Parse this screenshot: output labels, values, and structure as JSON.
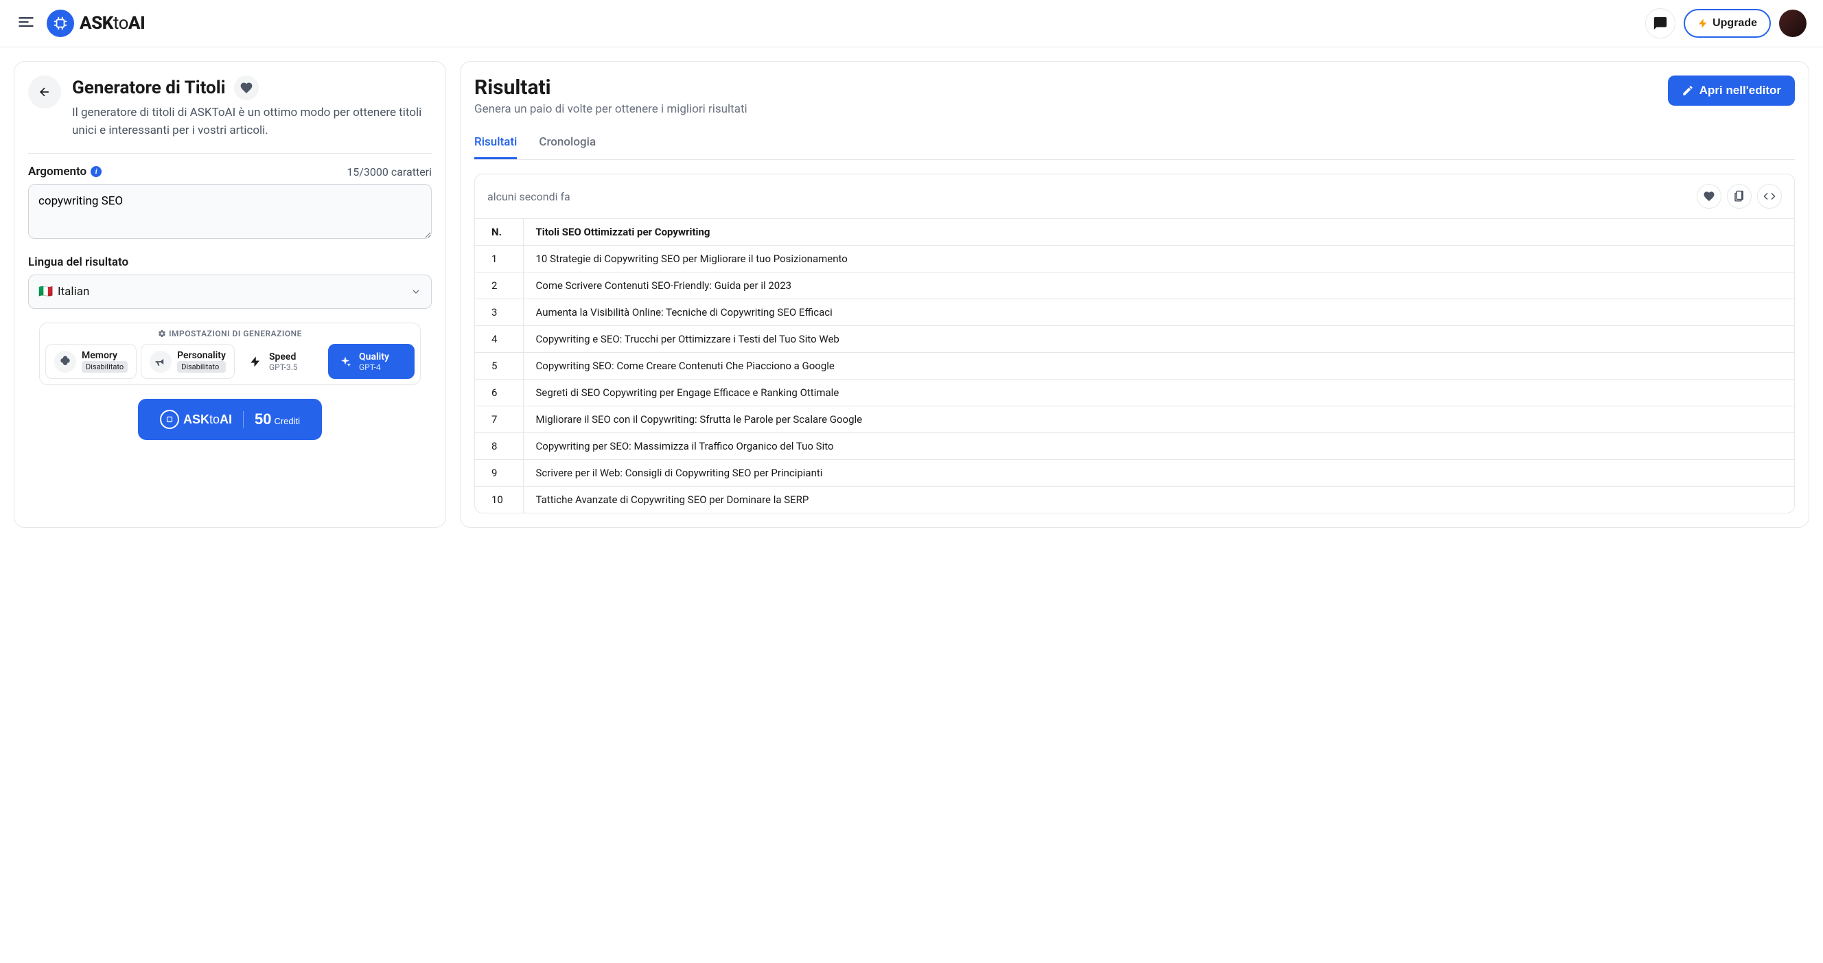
{
  "header": {
    "brand_ask": "ASK",
    "brand_to": "to",
    "brand_ai": "AI",
    "upgrade": "Upgrade"
  },
  "tool": {
    "title": "Generatore di Titoli",
    "description": "Il generatore di titoli di ASKToAI è un ottimo modo per ottenere titoli unici e interessanti per i vostri articoli."
  },
  "form": {
    "argomento_label": "Argomento",
    "char_count": "15/3000 caratteri",
    "argomento_value": "copywriting SEO",
    "lingua_label": "Lingua del risultato",
    "lingua_value": "Italian",
    "lingua_flag": "🇮🇹"
  },
  "gen": {
    "settings_title": "IMPOSTAZIONI DI GENERAZIONE",
    "memory_label": "Memory",
    "memory_status": "Disabilitato",
    "personality_label": "Personality",
    "personality_status": "Disabilitato",
    "speed_label": "Speed",
    "speed_sub": "GPT-3.5",
    "quality_label": "Quality",
    "quality_sub": "GPT-4"
  },
  "ask_button": {
    "brand_ask": "ASK",
    "brand_to": "to",
    "brand_ai": "AI",
    "credits_num": "50",
    "credits_label": "Crediti"
  },
  "results": {
    "title": "Risultati",
    "subtitle": "Genera un paio di volte per ottenere i migliori risultati",
    "editor_button": "Apri nell'editor",
    "tabs": {
      "risultati": "Risultati",
      "cronologia": "Cronologia"
    },
    "timestamp": "alcuni secondi fa",
    "table": {
      "col_n": "N.",
      "col_title": "Titoli SEO Ottimizzati per Copywriting",
      "rows": [
        {
          "n": "1",
          "title": "10 Strategie di Copywriting SEO per Migliorare il tuo Posizionamento"
        },
        {
          "n": "2",
          "title": "Come Scrivere Contenuti SEO-Friendly: Guida per il 2023"
        },
        {
          "n": "3",
          "title": "Aumenta la Visibilità Online: Tecniche di Copywriting SEO Efficaci"
        },
        {
          "n": "4",
          "title": "Copywriting e SEO: Trucchi per Ottimizzare i Testi del Tuo Sito Web"
        },
        {
          "n": "5",
          "title": "Copywriting SEO: Come Creare Contenuti Che Piacciono a Google"
        },
        {
          "n": "6",
          "title": "Segreti di SEO Copywriting per Engage Efficace e Ranking Ottimale"
        },
        {
          "n": "7",
          "title": "Migliorare il SEO con il Copywriting: Sfrutta le Parole per Scalare Google"
        },
        {
          "n": "8",
          "title": "Copywriting per SEO: Massimizza il Traffico Organico del Tuo Sito"
        },
        {
          "n": "9",
          "title": "Scrivere per il Web: Consigli di Copywriting SEO per Principianti"
        },
        {
          "n": "10",
          "title": "Tattiche Avanzate di Copywriting SEO per Dominare la SERP"
        }
      ]
    }
  }
}
